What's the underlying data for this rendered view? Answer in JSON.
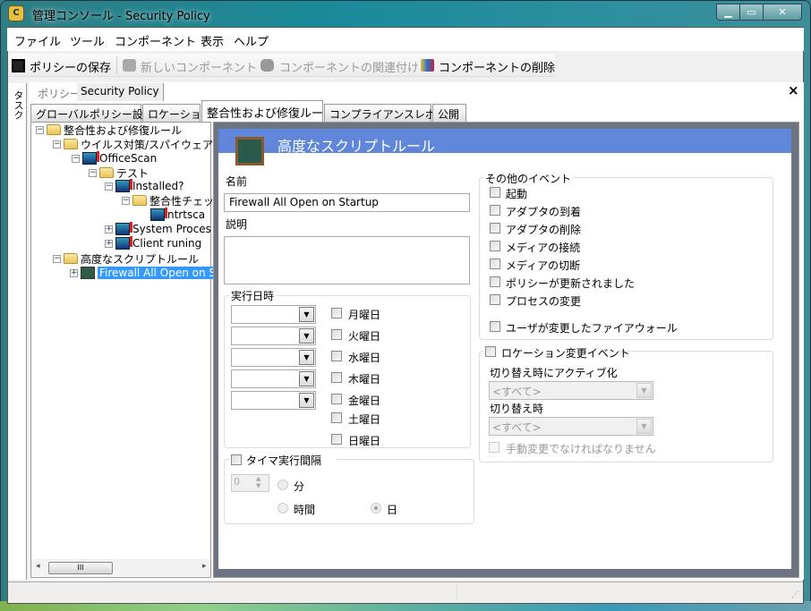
{
  "window": {
    "title": "管理コンソール - Security Policy",
    "app_icon": "console-icon",
    "min": "minimize",
    "max": "maximize",
    "close": "close"
  },
  "menu": [
    "ファイル",
    "ツール",
    "コンポーネント",
    "表示",
    "ヘルプ"
  ],
  "toolbar": {
    "save": "ポリシーの保存",
    "new_component": "新しいコンポーネント",
    "associate": "コンポーネントの関連付け",
    "delete": "コンポーネントの削除"
  },
  "task_strip": "タスク",
  "policy": {
    "label": "ポリシー",
    "name": "Security Policy",
    "close": "×"
  },
  "tabs": [
    "グローバルポリシー設定",
    "ロケーション",
    "整合性および修復ルール",
    "コンプライアンスレポート",
    "公開"
  ],
  "tree": [
    {
      "label": "整合性および修復ルール",
      "toggle": "−"
    },
    {
      "label": "ウイルス対策/スパイウェアル",
      "toggle": "−"
    },
    {
      "label": "OfficeScan",
      "toggle": "−"
    },
    {
      "label": "テスト",
      "toggle": "−"
    },
    {
      "label": "Installed?",
      "toggle": "−"
    },
    {
      "label": "整合性チェッ",
      "toggle": "−"
    },
    {
      "label": "ntrtsca"
    },
    {
      "label": "System Proces",
      "toggle": "+"
    },
    {
      "label": "Client runing",
      "toggle": "+"
    },
    {
      "label": "高度なスクリプトルール",
      "toggle": "−"
    },
    {
      "label": "Firewall All Open on St",
      "toggle": "+"
    }
  ],
  "scrollbar": {
    "grip": "III",
    "left": "◂",
    "right": "▸"
  },
  "form": {
    "title": "高度なスクリプトルール",
    "name_label": "名前",
    "name_value": "Firewall All Open on Startup",
    "desc_label": "説明",
    "desc_value": "",
    "schedule_label": "実行日時",
    "days": [
      "月曜日",
      "火曜日",
      "水曜日",
      "木曜日",
      "金曜日",
      "土曜日",
      "日曜日"
    ],
    "timer_label": "タイマ実行間隔",
    "timer_value": "0",
    "units": [
      "分",
      "時間",
      "日"
    ],
    "selected_unit": "日",
    "events_label": "その他のイベント",
    "events": [
      "起動",
      "アダプタの到着",
      "アダプタの削除",
      "メディアの接続",
      "メディアの切断",
      "ポリシーが更新されました",
      "プロセスの変更",
      "ユーザが変更したファイアウォール"
    ],
    "location_label": "ロケーション変更イベント",
    "activate_label": "切り替え時にアクティブ化",
    "activate_value": "<すべて>",
    "switch_label": "切り替え時",
    "switch_value": "<すべて>",
    "manual_label": "手動変更でなければなりません"
  }
}
